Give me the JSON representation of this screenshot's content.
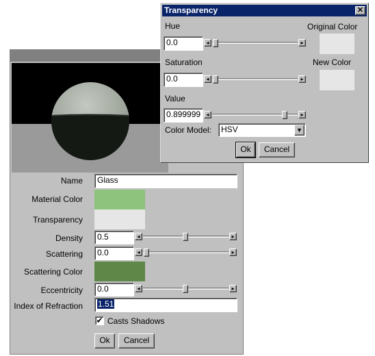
{
  "material_editor": {
    "fields": {
      "name": {
        "label": "Name",
        "value": "Glass"
      },
      "material_color": {
        "label": "Material Color",
        "color": "#8dc37d"
      },
      "transparency": {
        "label": "Transparency",
        "color": "#e6e6e6"
      },
      "density": {
        "label": "Density",
        "value": "0.5",
        "level": 0.5
      },
      "scattering": {
        "label": "Scattering",
        "value": "0.0",
        "level": 0.0
      },
      "scattering_color": {
        "label": "Scattering Color",
        "color": "#5e8748"
      },
      "eccentricity": {
        "label": "Eccentricity",
        "value": "0.0",
        "level": 0.5
      },
      "ior": {
        "label": "Index of Refraction",
        "value": "1.51"
      }
    },
    "casts_shadows": {
      "label": "Casts Shadows",
      "checked": true
    },
    "ok_label": "Ok",
    "cancel_label": "Cancel"
  },
  "transparency_dialog": {
    "title": "Transparency",
    "close_icon": "close-icon",
    "hue": {
      "label": "Hue",
      "value": "0.0",
      "level": 0.0
    },
    "saturation": {
      "label": "Saturation",
      "value": "0.0",
      "level": 0.0
    },
    "value": {
      "label": "Value",
      "value": "0.899999",
      "level": 0.9
    },
    "original_color": {
      "label": "Original Color",
      "color": "#e6e6e6"
    },
    "new_color": {
      "label": "New Color",
      "color": "#e6e6e6"
    },
    "color_model": {
      "label": "Color Model:",
      "selected": "HSV"
    },
    "ok_label": "Ok",
    "cancel_label": "Cancel"
  }
}
